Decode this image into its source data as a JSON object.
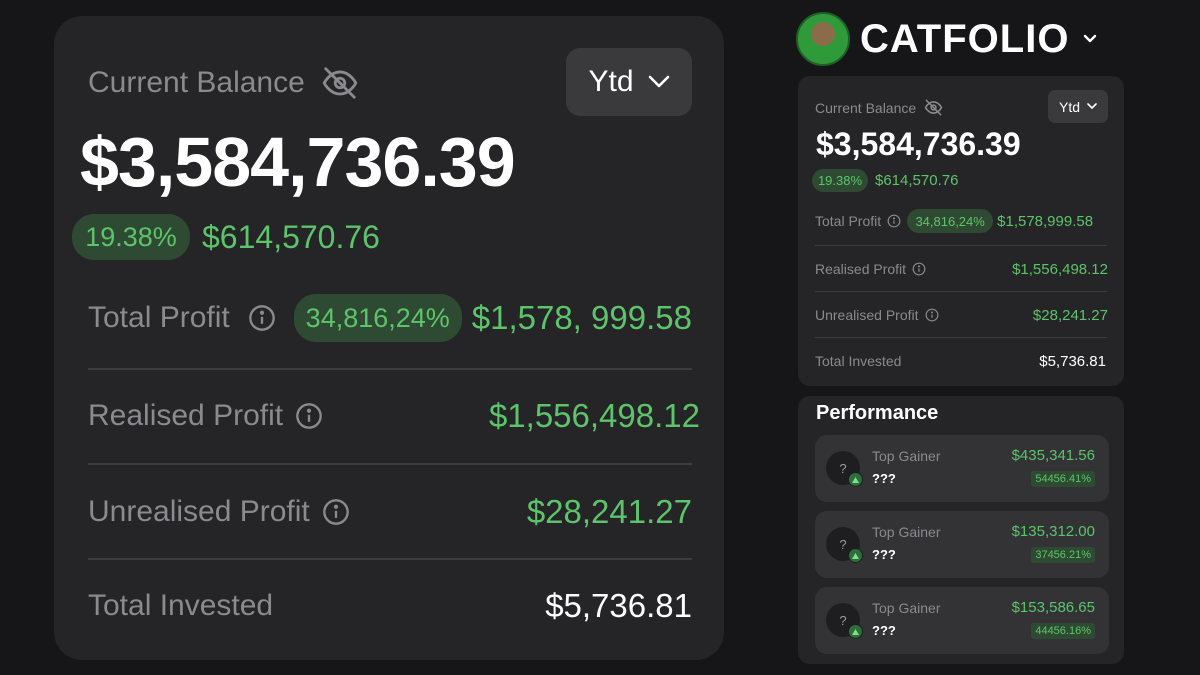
{
  "colors": {
    "background": "#161618",
    "card": "#252527",
    "accent_green": "#5cc46a",
    "pill_green_bg": "#2f4a32",
    "muted_text": "#8a8a8f"
  },
  "brand": {
    "name": "CATFOLIO",
    "avatar_icon": "cat-avatar",
    "dropdown_icon": "chevron-down-icon"
  },
  "overview_large": {
    "label": "Current Balance",
    "visibility_icon": "eye-off-icon",
    "period": "Ytd",
    "balance": "$3,584,736.39",
    "change_pct": "19.38%",
    "change_amount": "$614,570.76",
    "rows": [
      {
        "label": "Total Profit",
        "pct": "34,816,24%",
        "value": "$1,578, 999.58"
      },
      {
        "label": "Realised Profit",
        "value": "$1,556,498.12"
      },
      {
        "label": "Unrealised Profit",
        "value": "$28,241.27"
      },
      {
        "label": "Total Invested",
        "value": "$5,736.81"
      }
    ]
  },
  "overview_small": {
    "label": "Current Balance",
    "period": "Ytd",
    "balance": "$3,584,736.39",
    "change_pct": "19.38%",
    "change_amount": "$614,570.76",
    "rows": [
      {
        "label": "Total Profit",
        "pct": "34,816,24%",
        "value": "$1,578,999.58"
      },
      {
        "label": "Realised Profit",
        "value": "$1,556,498.12"
      },
      {
        "label": "Unrealised Profit",
        "value": "$28,241.27"
      },
      {
        "label": "Total Invested",
        "value": "$5,736.81"
      }
    ]
  },
  "performance": {
    "title": "Performance",
    "items": [
      {
        "label": "Top Gainer",
        "name": "???",
        "avatar": "?",
        "amount": "$435,341.56",
        "pct": "54456.41%"
      },
      {
        "label": "Top Gainer",
        "name": "???",
        "avatar": "?",
        "amount": "$135,312.00",
        "pct": "37456.21%"
      },
      {
        "label": "Top Gainer",
        "name": "???",
        "avatar": "?",
        "amount": "$153,586.65",
        "pct": "44456.16%"
      }
    ]
  }
}
